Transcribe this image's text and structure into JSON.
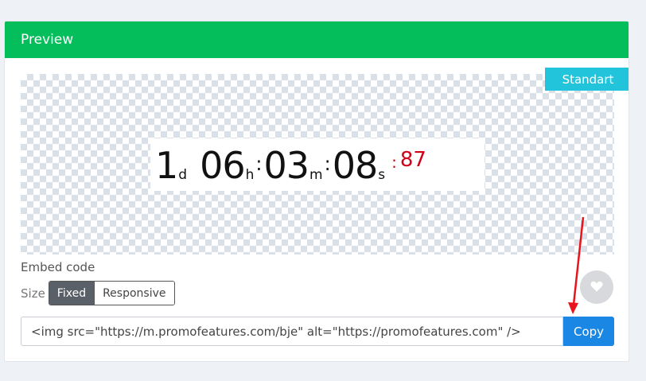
{
  "card": {
    "title": "Preview"
  },
  "style_badge": "Standart",
  "timer": {
    "days": "1",
    "days_unit": "d",
    "hours": "06",
    "hours_unit": "h",
    "minutes": "03",
    "minutes_unit": "m",
    "seconds": "08",
    "seconds_unit": "s",
    "separator": ":",
    "hundredths": "87",
    "hundredths_color": "#d0021b"
  },
  "embed": {
    "label": "Embed code",
    "size_label": "Size",
    "size_options": [
      "Fixed",
      "Responsive"
    ],
    "selected_size": "Fixed",
    "code_value": "<img src=\"https://m.promofeatures.com/bje\" alt=\"https://promofeatures.com\" />",
    "copy_label": "Copy"
  },
  "icons": {
    "like": "heart-icon",
    "annotation": "red-arrow-annotation"
  },
  "colors": {
    "header": "#03be5b",
    "badge": "#22c4dc",
    "copy_button": "#1b87e5",
    "annotation": "#e8141b"
  }
}
